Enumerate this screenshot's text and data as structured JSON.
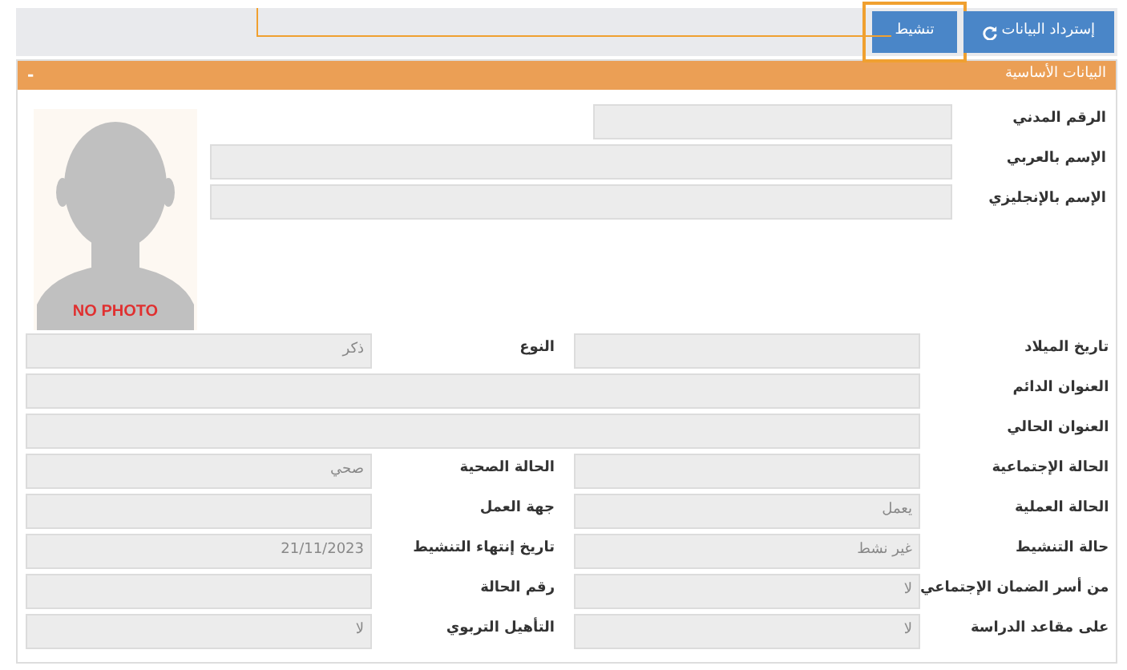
{
  "toolbar": [
    {
      "label": "إسترداد البيانات",
      "kind": "refresh",
      "highlighted": false
    },
    {
      "label": "تنشيط",
      "kind": "plain",
      "highlighted": true
    }
  ],
  "section": {
    "title": "البيانات الأساسية",
    "toggle": "-"
  },
  "photo": {
    "kind": "picture",
    "caption": "NO PHOTO"
  },
  "top_fields": [
    {
      "label": "الرقم المدني",
      "kind": "short"
    },
    {
      "label": "الإسم بالعربي",
      "kind": "wide"
    },
    {
      "label": "الإسم بالإنجليزي",
      "kind": "wide"
    }
  ],
  "rows": [
    {
      "label": "تاريخ الميلاد",
      "kind": "pair",
      "pair": {
        "label": "النوع",
        "value": "ذكر"
      }
    },
    {
      "label": "العنوان الدائم",
      "kind": "wide"
    },
    {
      "label": "العنوان الحالي",
      "kind": "wide"
    },
    {
      "label": "الحالة الإجتماعية",
      "kind": "pair",
      "pair": {
        "label": "الحالة الصحية",
        "value": "صحي"
      }
    },
    {
      "label": "الحالة العملية",
      "value": "يعمل",
      "kind": "pair",
      "pair": {
        "label": "جهة العمل"
      }
    },
    {
      "label": "حالة التنشيط",
      "value": "غير نشط",
      "kind": "pair",
      "pair": {
        "label": "تاريخ إنتهاء التنشيط",
        "value": "21/11/2023"
      }
    },
    {
      "label": "من أسر الضمان الإجتماعي",
      "value": "لا",
      "kind": "pair",
      "pair": {
        "label": "رقم الحالة"
      }
    },
    {
      "label": "على مقاعد الدراسة",
      "value": "لا",
      "kind": "pair",
      "pair": {
        "label": "التأهيل التربوي",
        "value": "لا"
      }
    }
  ]
}
